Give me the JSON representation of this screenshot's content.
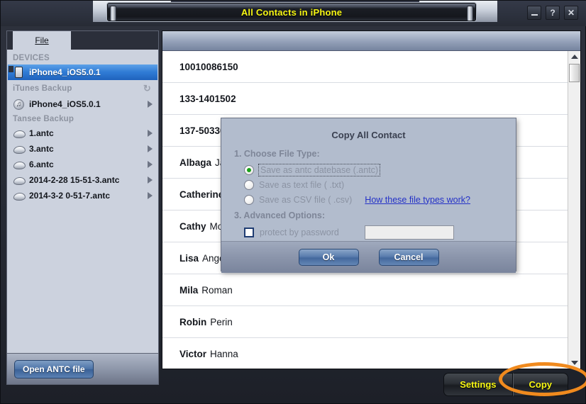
{
  "window": {
    "title": "All Contacts in iPhone",
    "controls": [
      {
        "name": "minimize",
        "label": ""
      },
      {
        "name": "help",
        "label": "?"
      },
      {
        "name": "close",
        "label": "✕"
      }
    ]
  },
  "sidebar": {
    "tab_label": "File",
    "groups": [
      {
        "label": "DEVICES",
        "refresh": false,
        "items": [
          {
            "label": "iPhone4_iOS5.0.1",
            "icon": "iphone-icon",
            "selected": true,
            "arrow": false
          }
        ]
      },
      {
        "label": "iTunes Backup",
        "refresh": true,
        "refresh_icon": "↻",
        "items": [
          {
            "label": "iPhone4_iOS5.0.1",
            "icon": "itunes-icon",
            "selected": false,
            "arrow": true
          }
        ]
      },
      {
        "label": "Tansee Backup",
        "refresh": false,
        "items": [
          {
            "label": "1.antc",
            "icon": "disc-icon",
            "selected": false,
            "arrow": true
          },
          {
            "label": "3.antc",
            "icon": "disc-icon",
            "selected": false,
            "arrow": true
          },
          {
            "label": "6.antc",
            "icon": "disc-icon",
            "selected": false,
            "arrow": true
          },
          {
            "label": "2014-2-28 15-51-3.antc",
            "icon": "disc-icon",
            "selected": false,
            "arrow": true
          },
          {
            "label": "2014-3-2 0-51-7.antc",
            "icon": "disc-icon",
            "selected": false,
            "arrow": true
          }
        ]
      }
    ],
    "open_antc_label": "Open ANTC file"
  },
  "contacts": [
    {
      "first": "10010086150",
      "last": ""
    },
    {
      "first": "133-1401502",
      "last": ""
    },
    {
      "first": "137-50330",
      "last": ""
    },
    {
      "first": "Albaga",
      "last": "Ja"
    },
    {
      "first": "Catherine",
      "last": ""
    },
    {
      "first": "Cathy",
      "last": "Mor"
    },
    {
      "first": "Lisa",
      "last": "Ange"
    },
    {
      "first": "Mila",
      "last": "Roman"
    },
    {
      "first": "Robin",
      "last": "Perin"
    },
    {
      "first": "Victor",
      "last": "Hanna"
    }
  ],
  "bottom": {
    "settings_label": "Settings",
    "copy_label": "Copy",
    "highlight_color": "#f08a1e"
  },
  "dialog": {
    "title": "Copy All Contact",
    "section1": "1. Choose File Type:",
    "options": [
      {
        "label": "Save as antc datebase (.antc)",
        "selected": true,
        "focused": true
      },
      {
        "label": "Save as text file ( .txt)",
        "selected": false,
        "focused": false
      },
      {
        "label": "Save as CSV file ( .csv)",
        "selected": false,
        "focused": false
      }
    ],
    "help_link": "How these file types work?",
    "section3": "3. Advanced Options:",
    "protect_label": "protect by password",
    "protect_checked": false,
    "password_value": "",
    "password_placeholder": "",
    "ok_label": "Ok",
    "cancel_label": "Cancel"
  },
  "scrollbar": {
    "up_icon": "triangle-up-icon",
    "down_icon": "triangle-down-icon"
  }
}
